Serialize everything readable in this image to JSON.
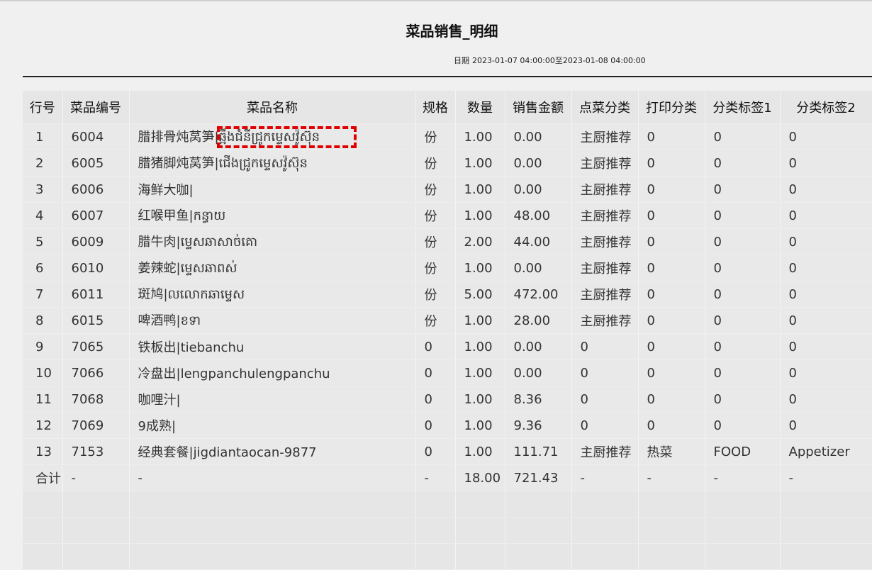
{
  "report": {
    "title": "菜品销售_明细",
    "date_label": "日期",
    "date_range": "2023-01-07 04:00:00至2023-01-08 04:00:00"
  },
  "table": {
    "headers": [
      "行号",
      "菜品编号",
      "菜品名称",
      "规格",
      "数量",
      "销售金额",
      "点菜分类",
      "打印分类",
      "分类标签1",
      "分类标签2"
    ],
    "rows": [
      [
        "1",
        "6004",
        "腊排骨炖莴笋|ឆ្អឹងជំនីជ្រូកម្ទេសវ៉ូស៊ុន",
        "份",
        "1.00",
        "0.00",
        "主厨推荐",
        "0",
        "0",
        "0"
      ],
      [
        "2",
        "6005",
        "腊猪脚炖莴笋|ជើងជ្រូកម្ទេសវ៉ូស៊ុន",
        "份",
        "1.00",
        "0.00",
        "主厨推荐",
        "0",
        "0",
        "0"
      ],
      [
        "3",
        "6006",
        "海鲜大咖|",
        "份",
        "1.00",
        "0.00",
        "主厨推荐",
        "0",
        "0",
        "0"
      ],
      [
        "4",
        "6007",
        "红喉甲鱼|កន្ធាយ",
        "份",
        "1.00",
        "48.00",
        "主厨推荐",
        "0",
        "0",
        "0"
      ],
      [
        "5",
        "6009",
        "腊牛肉|ម្ទេសឆាសាច់គោ",
        "份",
        "2.00",
        "44.00",
        "主厨推荐",
        "0",
        "0",
        "0"
      ],
      [
        "6",
        "6010",
        "姜辣蛇|ម្ទេសឆាពស់",
        "份",
        "1.00",
        "0.00",
        "主厨推荐",
        "0",
        "0",
        "0"
      ],
      [
        "7",
        "6011",
        "斑鸠|លលោកឆាម្ទេស",
        "份",
        "5.00",
        "472.00",
        "主厨推荐",
        "0",
        "0",
        "0"
      ],
      [
        "8",
        "6015",
        "啤酒鸭|ខទា",
        "份",
        "1.00",
        "28.00",
        "主厨推荐",
        "0",
        "0",
        "0"
      ],
      [
        "9",
        "7065",
        "铁板出|tiebanchu",
        "0",
        "1.00",
        "0.00",
        "0",
        "0",
        "0",
        "0"
      ],
      [
        "10",
        "7066",
        "冷盘出|lengpanchulengpanchu",
        "0",
        "1.00",
        "0.00",
        "0",
        "0",
        "0",
        "0"
      ],
      [
        "11",
        "7068",
        "咖哩汁|",
        "0",
        "1.00",
        "8.36",
        "0",
        "0",
        "0",
        "0"
      ],
      [
        "12",
        "7069",
        "9成熟|",
        "0",
        "1.00",
        "9.36",
        "0",
        "0",
        "0",
        "0"
      ],
      [
        "13",
        "7153",
        "经典套餐|jigdiantaocan-9877",
        "0",
        "1.00",
        "111.71",
        "主厨推荐",
        "热菜",
        "FOOD",
        "Appetizer"
      ],
      [
        "合计",
        "-",
        "-",
        "-",
        "18.00",
        "721.43",
        "-",
        "-",
        "-",
        "-"
      ]
    ]
  }
}
